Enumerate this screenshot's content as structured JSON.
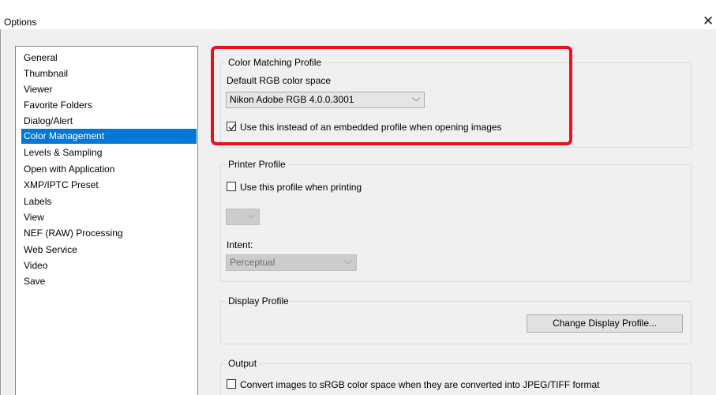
{
  "window": {
    "title": "Options",
    "close_glyph": "✕"
  },
  "sidebar": {
    "items": [
      {
        "label": "General"
      },
      {
        "label": "Thumbnail"
      },
      {
        "label": "Viewer"
      },
      {
        "label": "Favorite Folders"
      },
      {
        "label": "Dialog/Alert"
      },
      {
        "label": "Color Management",
        "selected": true
      },
      {
        "label": "Levels & Sampling"
      },
      {
        "label": "Open with Application"
      },
      {
        "label": "XMP/IPTC Preset"
      },
      {
        "label": "Labels"
      },
      {
        "label": "View"
      },
      {
        "label": "NEF (RAW) Processing"
      },
      {
        "label": "Web Service"
      },
      {
        "label": "Video"
      },
      {
        "label": "Save"
      }
    ]
  },
  "color_matching": {
    "group_label": "Color Matching Profile",
    "rgb_label": "Default RGB color space",
    "rgb_value": "Nikon Adobe RGB 4.0.0.3001",
    "embedded_checkbox_label": "Use this instead of an embedded profile when opening images",
    "embedded_checked": true
  },
  "printer": {
    "group_label": "Printer Profile",
    "use_checkbox_label": "Use this profile when printing",
    "use_checked": false,
    "profile_value": "",
    "intent_label": "Intent:",
    "intent_value": "Perceptual"
  },
  "display": {
    "group_label": "Display Profile",
    "change_button": "Change Display Profile..."
  },
  "output": {
    "group_label": "Output",
    "convert_checkbox_label": "Convert images to sRGB color space when they are converted into JPEG/TIFF format",
    "convert_checked": false
  },
  "colors": {
    "selection": "#0078d7",
    "highlight_border": "#e8121c",
    "dialog_bg": "#f0f0f0"
  },
  "icons": {
    "close": "close-icon",
    "dropdown": "chevron-down-icon",
    "check": "checkmark-icon"
  }
}
